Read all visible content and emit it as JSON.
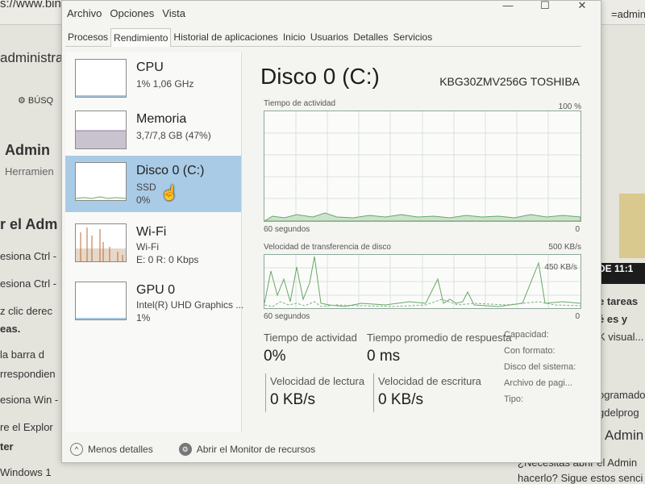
{
  "window": {
    "menu": [
      "Archivo",
      "Opciones",
      "Vista"
    ],
    "tabs": [
      {
        "label": "Procesos",
        "active": false
      },
      {
        "label": "Rendimiento",
        "active": true
      },
      {
        "label": "Historial de aplicaciones",
        "active": false
      },
      {
        "label": "Inicio",
        "active": false
      },
      {
        "label": "Usuarios",
        "active": false
      },
      {
        "label": "Detalles",
        "active": false
      },
      {
        "label": "Servicios",
        "active": false
      }
    ],
    "title_buttons": [
      "—",
      "☐",
      "✕"
    ]
  },
  "sidebar": {
    "items": [
      {
        "title": "CPU",
        "sub1": "1% 1,06 GHz",
        "sub2": ""
      },
      {
        "title": "Memoria",
        "sub1": "3,7/7,8 GB (47%)",
        "sub2": ""
      },
      {
        "title": "Disco 0 (C:)",
        "sub1": "SSD",
        "sub2": "0%",
        "selected": true
      },
      {
        "title": "Wi-Fi",
        "sub1": "Wi-Fi",
        "sub2": "E: 0 R: 0 Kbps"
      },
      {
        "title": "GPU 0",
        "sub1": "Intel(R) UHD Graphics ...",
        "sub2": "1%"
      }
    ]
  },
  "main": {
    "title": "Disco 0 (C:)",
    "model": "KBG30ZMV256G TOSHIBA",
    "graph1": {
      "label": "Tiempo de actividad",
      "max": "100 %",
      "xleft": "60 segundos",
      "xright": "0"
    },
    "graph2": {
      "label": "Velocidad de transferencia de disco",
      "max": "500 KB/s",
      "inner": "450 KB/s",
      "xleft": "60 segundos",
      "xright": "0"
    },
    "stats": {
      "active_label": "Tiempo de actividad",
      "active_value": "0%",
      "response_label": "Tiempo promedio de respuesta",
      "response_value": "0 ms",
      "read_label": "Velocidad de lectura",
      "read_value": "0 KB/s",
      "write_label": "Velocidad de escritura",
      "write_value": "0 KB/s"
    },
    "properties": [
      "Capacidad:",
      "Con formato:",
      "Disco del sistema:",
      "Archivo de pagi...",
      "Tipo:"
    ]
  },
  "footer": {
    "less_details": "Menos detalles",
    "resource_monitor": "Abrir el Monitor de recursos"
  },
  "background": {
    "url": "s://www.bin",
    "url_right": "=admin",
    "admin": "administra",
    "buscar": "BÚSQ",
    "heading": "Admin",
    "herramien": "Herramien",
    "section": "r el Adm",
    "lines": [
      "esiona Ctrl -",
      "esiona Ctrl -",
      "z clic derec",
      "eas.",
      "la barra d",
      "rrespondien",
      "esiona Win -",
      "re el Explor",
      "ter",
      "Windows 1"
    ],
    "right_lines": [
      "e tareas",
      "é es y",
      "K visual...",
      "ogramado",
      "gdelprog",
      "Admin"
    ],
    "bottom": "¿Necesitas abrir el Admin",
    "bottom2": "hacerlo? Sigue estos senci",
    "dark_badge": "DE 11:1"
  }
}
